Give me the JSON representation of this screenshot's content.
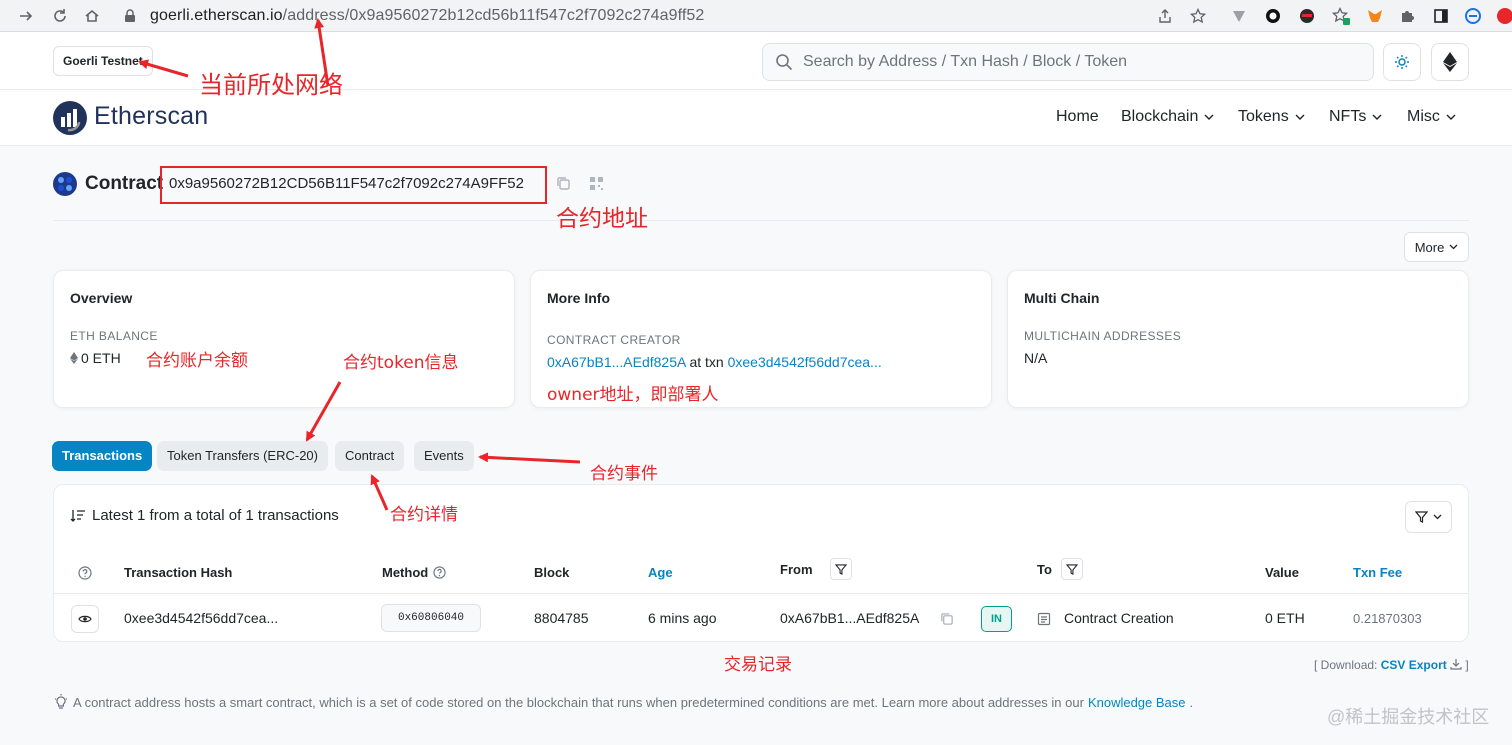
{
  "browser": {
    "url_domain": "goerli.etherscan.io",
    "url_path": "/address/0x9a9560272b12cd56b11f547c2f7092c274a9ff52"
  },
  "topbar": {
    "network": "Goerli Testnet",
    "search_placeholder": "Search by Address / Txn Hash / Block / Token"
  },
  "header": {
    "logo": "Etherscan",
    "nav": [
      "Home",
      "Blockchain",
      "Tokens",
      "NFTs",
      "Misc"
    ]
  },
  "contract": {
    "label": "Contract",
    "address": "0x9a9560272B12CD56B11F547c2f7092c274A9FF52",
    "more": "More"
  },
  "overview": {
    "title": "Overview",
    "balance_label": "ETH BALANCE",
    "balance_value": "0 ETH"
  },
  "more_info": {
    "title": "More Info",
    "creator_label": "CONTRACT CREATOR",
    "creator_address": "0xA67bB1...AEdf825A",
    "at_txn": "at txn",
    "creator_txn": "0xee3d4542f56dd7cea..."
  },
  "multi_chain": {
    "title": "Multi Chain",
    "label": "MULTICHAIN ADDRESSES",
    "value": "N/A"
  },
  "tabs": [
    "Transactions",
    "Token Transfers (ERC-20)",
    "Contract",
    "Events"
  ],
  "transactions": {
    "summary": "Latest 1 from a total of 1 transactions",
    "columns": {
      "hash": "Transaction Hash",
      "method": "Method",
      "block": "Block",
      "age": "Age",
      "from": "From",
      "to": "To",
      "value": "Value",
      "fee": "Txn Fee"
    },
    "rows": [
      {
        "hash": "0xee3d4542f56dd7cea...",
        "method": "0x60806040",
        "block": "8804785",
        "age": "6 mins ago",
        "from": "0xA67bB1...AEdf825A",
        "direction": "IN",
        "to": "Contract Creation",
        "value": "0 ETH",
        "fee": "0.21870303"
      }
    ],
    "download_prefix": "[ Download:",
    "download_link": "CSV Export",
    "download_suffix": "]"
  },
  "footnote": {
    "text": "A contract address hosts a smart contract, which is a set of code stored on the blockchain that runs when predetermined conditions are met. Learn more about addresses in our",
    "link": "Knowledge Base",
    "end": "."
  },
  "annotations": {
    "network": "当前所处网络",
    "contract_address": "合约地址",
    "balance": "合约账户余额",
    "token_info": "合约token信息",
    "owner": "owner地址，即部署人",
    "events": "合约事件",
    "contract_detail": "合约详情",
    "records": "交易记录"
  },
  "watermark": "@稀土掘金技术社区",
  "colors": {
    "primary": "#0784c3",
    "annotation": "#e8262a",
    "in_badge": "#00a186"
  }
}
